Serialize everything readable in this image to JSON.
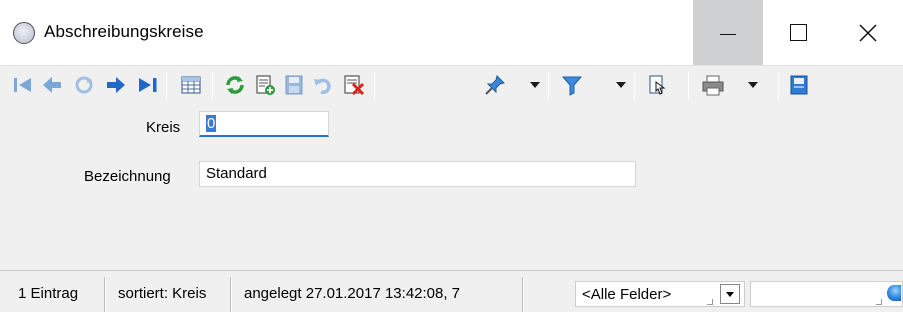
{
  "window": {
    "title": "Abschreibungskreise",
    "controls": {
      "minimize": "minimize",
      "maximize": "maximize",
      "close": "close"
    }
  },
  "toolbar": {
    "buttons": [
      "first-record-icon",
      "previous-record-icon",
      "refresh-disabled-icon",
      "next-record-icon",
      "last-record-icon",
      "table-view-icon",
      "reload-icon",
      "new-record-icon",
      "save-icon",
      "undo-icon",
      "delete-icon",
      "pin-icon",
      "filter-icon",
      "export-icon",
      "print-icon",
      "close-form-icon"
    ]
  },
  "form": {
    "kreis_label": "Kreis",
    "kreis_value": "0",
    "bezeichnung_label": "Bezeichnung",
    "bezeichnung_value": "Standard"
  },
  "statusbar": {
    "count": "1 Eintrag",
    "sort": "sortiert: Kreis",
    "created": "angelegt 27.01.2017 13:42:08,  7",
    "field_filter": "<Alle Felder>",
    "search_value": ""
  },
  "colors": {
    "toolbar_bg": "#f0f0f0",
    "accent_blue": "#2a6fd6",
    "minimize_hover": "#cfd0d2"
  }
}
